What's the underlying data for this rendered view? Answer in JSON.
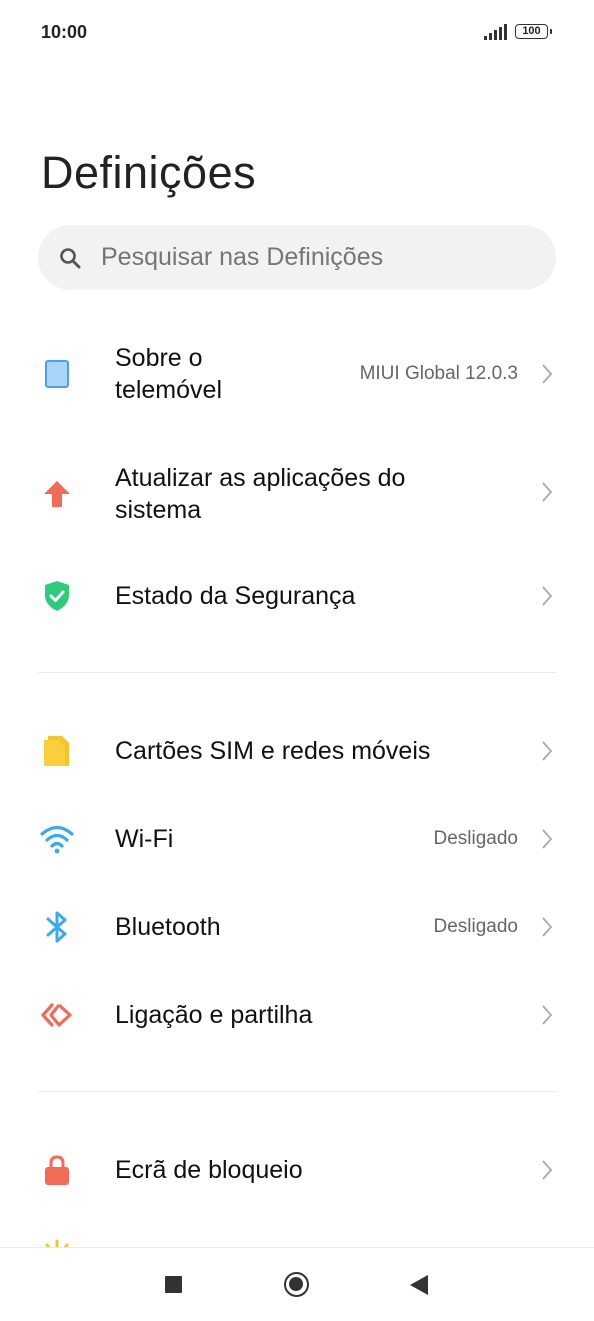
{
  "status_bar": {
    "time": "10:00",
    "battery": "100"
  },
  "page": {
    "title": "Definições"
  },
  "search": {
    "placeholder": "Pesquisar nas Definições"
  },
  "items": [
    {
      "label_line1": "Sobre o",
      "label_line2": "telemóvel",
      "value": "MIUI Global 12.0.3",
      "icon": "phone-icon",
      "color": "#5aa9f0"
    },
    {
      "label_line1": "Atualizar as aplicações do",
      "label_line2": "sistema",
      "icon": "update-arrow-icon",
      "color": "#f26b55"
    },
    {
      "label": "Estado da Segurança",
      "icon": "shield-check-icon",
      "color": "#2ecc7a"
    },
    {
      "label": "Cartões SIM e redes móveis",
      "icon": "sim-card-icon",
      "color": "#f7c325"
    },
    {
      "label": "Wi-Fi",
      "value": "Desligado",
      "icon": "wifi-icon",
      "color": "#3aa8f2"
    },
    {
      "label": "Bluetooth",
      "value": "Desligado",
      "icon": "bluetooth-icon",
      "color": "#3aa8f2"
    },
    {
      "label": "Ligação e partilha",
      "icon": "connection-sharing-icon",
      "color": "#f26b55"
    },
    {
      "label": "Ecrã de bloqueio",
      "icon": "lock-icon",
      "color": "#f26b55"
    }
  ],
  "nav": {
    "icons": [
      "recents-icon",
      "home-icon",
      "back-icon"
    ]
  }
}
